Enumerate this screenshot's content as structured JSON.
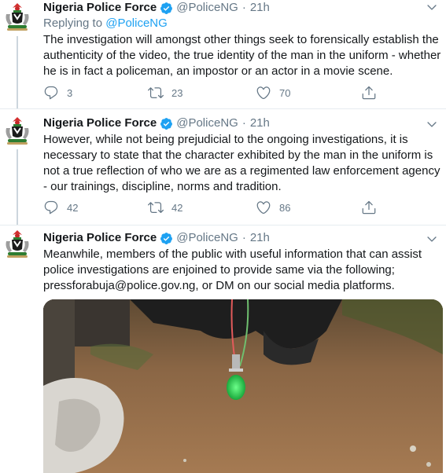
{
  "tweets": [
    {
      "name": "Nigeria Police Force",
      "handle": "@PoliceNG",
      "dot": "·",
      "time": "21h",
      "replying_prefix": "Replying to",
      "replying_handle": "@PoliceNG",
      "text": "The investigation will amongst other things seek to forensically establish the authenticity of the video, the true identity of the man in the uniform - whether he is in fact a policeman, an impostor or an actor in a movie scene.",
      "replies": "3",
      "retweets": "23",
      "likes": "70"
    },
    {
      "name": "Nigeria Police Force",
      "handle": "@PoliceNG",
      "dot": "·",
      "time": "21h",
      "text": "However, while not being prejudicial to the ongoing investigations, it is necessary to state that the character exhibited by the man in the uniform is not a true reflection of who we are as a regimented law enforcement agency - our trainings, discipline, norms and tradition.",
      "replies": "42",
      "retweets": "42",
      "likes": "86"
    },
    {
      "name": "Nigeria Police Force",
      "handle": "@PoliceNG",
      "dot": "·",
      "time": "21h",
      "text": "Meanwhile, members of the public with useful information that can assist police investigations are enjoined to provide same via the following; pressforabuja@police.gov.ng, or DM on our social media platforms."
    }
  ],
  "icons": {
    "reply": "reply-icon",
    "retweet": "retweet-icon",
    "like": "heart-icon",
    "share": "share-icon",
    "verified": "verified-badge-icon",
    "caret": "chevron-down-icon"
  },
  "colors": {
    "link": "#1da1f2",
    "secondary_text": "#657786",
    "verified": "#1da1f2",
    "divider": "#e6ecf0"
  }
}
